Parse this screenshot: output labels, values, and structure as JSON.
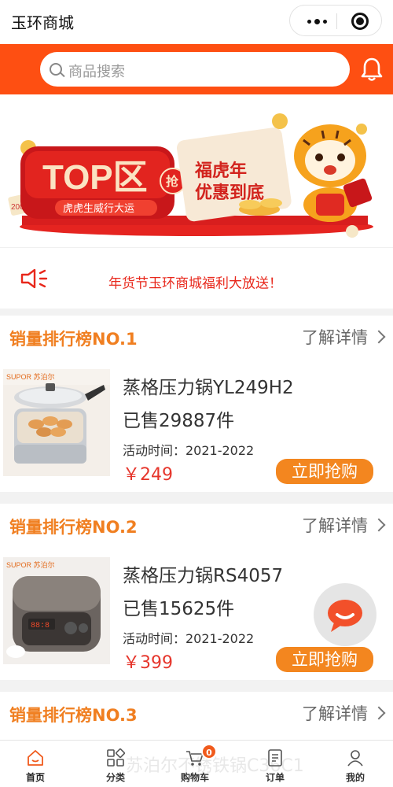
{
  "app": {
    "title": "玉环商城"
  },
  "search": {
    "placeholder": "商品搜索"
  },
  "banner": {
    "top_label": "TOP区",
    "grab_label": "抢",
    "slogan_sub": "虎虎生威行大运",
    "slogan_line1": "福虎年",
    "slogan_line2": "优惠到底",
    "coupon_label": "200"
  },
  "promo": {
    "text": "年货节玉环商城福利大放送！"
  },
  "rankings": [
    {
      "title": "销量排行榜NO.1",
      "detail": "了解详情",
      "name": "蒸格压力锅YL249H2",
      "sold": "已售29887件",
      "period": "活动时间：2021-2022",
      "price": "￥249",
      "buy": "立即抢购",
      "brand": "SUPOR 苏泊尔"
    },
    {
      "title": "销量排行榜NO.2",
      "detail": "了解详情",
      "name": "蒸格压力锅RS4057",
      "sold": "已售15625件",
      "period": "活动时间：2021-2022",
      "price": "￥399",
      "buy": "立即抢购",
      "brand": "SUPOR 苏泊尔"
    },
    {
      "title": "销量排行榜NO.3",
      "detail": "了解详情"
    }
  ],
  "ghost_text": "苏泊尔不锈铁锅C36C1",
  "tabs": [
    {
      "label": "首页",
      "icon": "home-icon"
    },
    {
      "label": "分类",
      "icon": "category-icon"
    },
    {
      "label": "购物车",
      "icon": "cart-icon",
      "badge": "0"
    },
    {
      "label": "订单",
      "icon": "order-icon"
    },
    {
      "label": "我的",
      "icon": "user-icon"
    }
  ],
  "colors": {
    "brand": "#fe4f12",
    "accent": "#f3861f",
    "price": "#e6362c",
    "heading": "#f07f21"
  }
}
